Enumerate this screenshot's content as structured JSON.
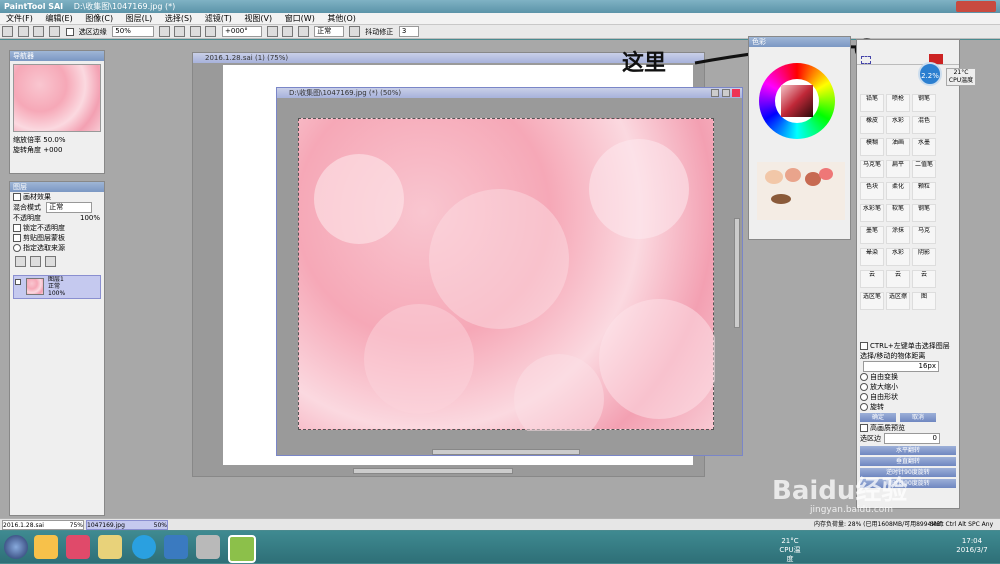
{
  "window": {
    "title": "D:\\收集图\\1047169.jpg (*)",
    "app_logo": "PaintTool SAI"
  },
  "menu": [
    "文件(F)",
    "编辑(E)",
    "图像(C)",
    "图层(L)",
    "选择(S)",
    "滤镜(T)",
    "视图(V)",
    "窗口(W)",
    "其他(O)"
  ],
  "toolbar": {
    "selection_edge_label": "选区边缘",
    "zoom": "50%",
    "rotation": "+000°",
    "blend_mode": "正常",
    "stabilizer_label": "抖动修正",
    "stabilizer_value": "3"
  },
  "navigator": {
    "title": "导航器",
    "zoom_label": "缩放倍率",
    "zoom_value": "50.0%",
    "rotate_label": "旋转角度",
    "rotate_value": "+000"
  },
  "layers": {
    "title": "图层",
    "texture_label": "画材效果",
    "blend_label": "混合模式",
    "blend_value": "正常",
    "opacity_label": "不透明度",
    "opacity_value": "100%",
    "options": [
      "锁定不透明度",
      "剪贴图层蒙板",
      "指定选取来源"
    ],
    "layer_name": "图层1",
    "layer_mode": "正常",
    "layer_opacity": "100%"
  },
  "background_doc": {
    "title": "2016.1.28.sai (1) (75%)"
  },
  "main_doc": {
    "title": "D:\\收集图\\1047169.jpg (*) (50%)"
  },
  "annotation": {
    "text": "这里"
  },
  "color_panel": {
    "title": "色彩"
  },
  "tools_panel": {
    "brushes": [
      [
        "铅笔",
        "喷枪",
        "钢笔"
      ],
      [
        "橡皮",
        "水彩",
        "混色"
      ],
      [
        "模糊",
        "油画",
        "水墨"
      ],
      [
        "马克笔",
        "扁平",
        "二值笔"
      ],
      [
        "色块",
        "柔化",
        "颗粒"
      ],
      [
        "水彩笔",
        "软笔",
        "钢笔"
      ],
      [
        "墨笔",
        "涂抹",
        "马克"
      ],
      [
        "晕染",
        "水彩",
        "阴影"
      ],
      [
        "云",
        "云",
        "云"
      ],
      [
        "选区笔",
        "选区擦",
        "图"
      ]
    ],
    "ctrl_label": "CTRL+左键单击选择图层",
    "distance_label": "选择/移动的物体距离",
    "distance_value": "16px",
    "radio_options": [
      "自由变换",
      "放大缩小",
      "自由形状",
      "旋转"
    ],
    "ok_label": "确定",
    "cancel_label": "取消",
    "hq_preview_label": "高画质预览",
    "antialias_label": "选区边",
    "antialias_value": "0",
    "buttons": [
      "水平翻转",
      "垂直翻转",
      "逆时针90度旋转",
      "顺时针90度旋转"
    ]
  },
  "status": {
    "tab1_name": "2016.1.28.sai",
    "tab1_zoom": "75%",
    "tab2_name": "1047169.jpg",
    "tab2_zoom": "50%",
    "memory_label": "内存负荷量: 28% (已用1608MB/可用8994MB)",
    "keys": "Shift Ctrl Alt SPC Any"
  },
  "widget": {
    "percent": "2.2%",
    "temp": "21°C",
    "label": "CPU温度"
  },
  "taskbar": {
    "temp": "21°C",
    "temp_label": "CPU温度",
    "time": "17:04",
    "date": "2016/3/7"
  },
  "watermark": {
    "text": "Baidu经验",
    "url": "jingyan.baidu.com"
  }
}
